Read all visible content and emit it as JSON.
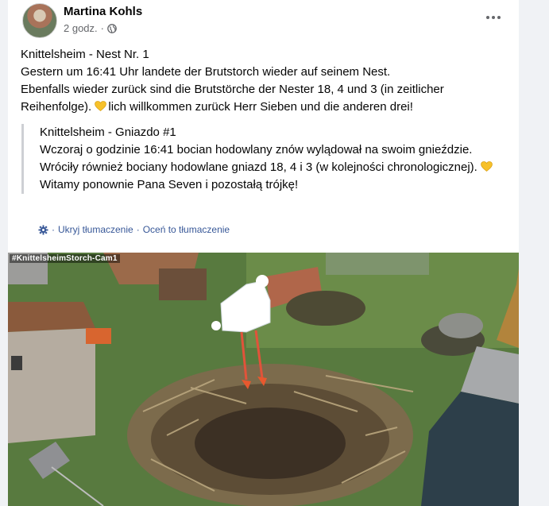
{
  "post": {
    "author": "Martina Kohls",
    "time": "2 godz.",
    "dot": "·",
    "text": {
      "line1": "Knittelsheim - Nest Nr. 1",
      "line2": "Gestern um 16:41 Uhr landete der Brutstorch wieder auf seinem Nest.",
      "line3": "Ebenfalls wieder zurück sind die Brutstörche der Nester 18, 4 und 3 (in zeitlicher Reihenfolge).",
      "line3b": "lich willkommen zurück Herr Sieben und die anderen drei!"
    },
    "translation": {
      "line1": "Knittelsheim - Gniazdo #1",
      "line2": "Wczoraj o godzinie 16:41 bocian hodowlany znów wylądował na swoim gnieździe.",
      "line3": "Wróciły również bociany hodowlane gniazd 18, 4 i 3 (w kolejności chronologicznej).",
      "line3b": "Witamy ponownie Pana Seven i pozostałą trójkę!"
    },
    "translation_links": {
      "hide": "Ukryj tłumaczenie",
      "sep": "·",
      "rate": "Oceń to tłumaczenie"
    },
    "image": {
      "label": "#KnittelsheimStorch-Cam1"
    }
  },
  "colors": {
    "link": "#385898",
    "meta": "#65676b",
    "heart": "#f7c12a",
    "page_bg": "#f0f2f5"
  },
  "icons": [
    "avatar",
    "globe-icon",
    "more-options-icon",
    "yellow-heart-icon",
    "translate-gear-icon"
  ]
}
